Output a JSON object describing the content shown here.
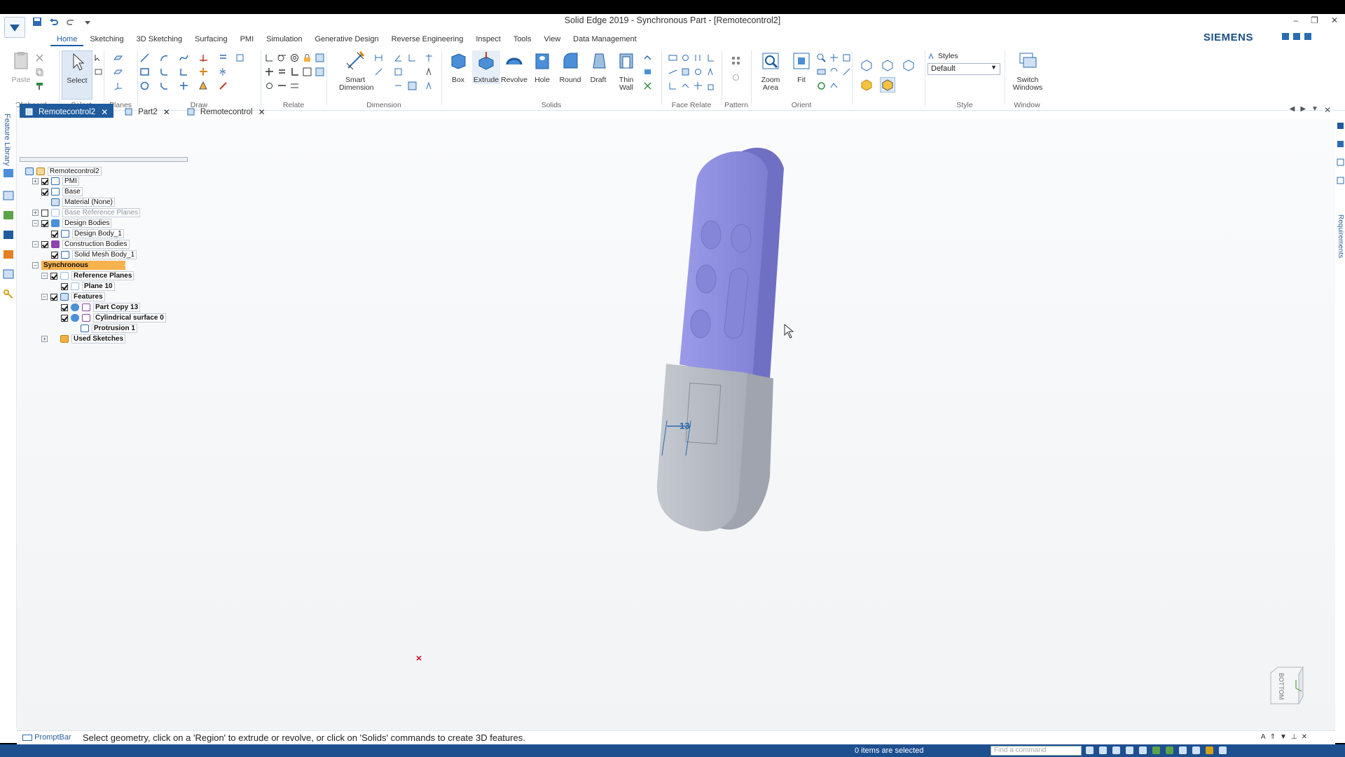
{
  "window": {
    "title": "Solid Edge 2019 - Synchronous Part - [Remotecontrol2]",
    "controls": [
      "–",
      "❐",
      "✕"
    ]
  },
  "brand": "SIEMENS",
  "ribbon_tabs": [
    "Home",
    "Sketching",
    "3D Sketching",
    "Surfacing",
    "PMI",
    "Simulation",
    "Generative Design",
    "Reverse Engineering",
    "Inspect",
    "Tools",
    "View",
    "Data Management"
  ],
  "ribbon": {
    "clipboard": {
      "paste": "Paste",
      "group": "Clipboard"
    },
    "select": {
      "select": "Select",
      "group": "Select"
    },
    "planes": {
      "group": "Planes"
    },
    "draw": {
      "group": "Draw"
    },
    "relate": {
      "group": "Relate"
    },
    "dimension": {
      "smart_dimension": "Smart Dimension",
      "group": "Dimension"
    },
    "solids": {
      "box": "Box",
      "extrude": "Extrude",
      "revolve": "Revolve",
      "hole": "Hole",
      "round": "Round",
      "draft": "Draft",
      "thin_wall": "Thin Wall",
      "group": "Solids"
    },
    "face_relate": {
      "group": "Face Relate"
    },
    "pattern": {
      "group": "Pattern"
    },
    "orient": {
      "zoom_area": "Zoom Area",
      "fit": "Fit",
      "group": "Orient"
    },
    "style": {
      "styles_label": "Styles",
      "style_value": "Default",
      "group": "Style"
    },
    "window": {
      "switch_windows": "Switch Windows",
      "group": "Window"
    }
  },
  "doc_tabs": [
    {
      "label": "Remotecontrol2",
      "active": true
    },
    {
      "label": "Part2",
      "active": false
    },
    {
      "label": "Remotecontrol",
      "active": false
    }
  ],
  "left_rail": {
    "label": "Feature Library"
  },
  "right_rail": {
    "label": "Requirements"
  },
  "tree": {
    "root": "Remotecontrol2",
    "pmi": "PMI",
    "base": "Base",
    "material": "Material (None)",
    "base_ref_planes": "Base Reference Planes",
    "design_bodies": "Design Bodies",
    "design_body_1": "Design Body_1",
    "construction_bodies": "Construction Bodies",
    "solid_mesh_body_1": "Solid Mesh Body_1",
    "synchronous": "Synchronous",
    "reference_planes": "Reference Planes",
    "plane_10": "Plane 10",
    "features": "Features",
    "part_copy_13": "Part Copy 13",
    "cyl_surface_0": "Cylindrical surface 0",
    "protrusion_1": "Protrusion 1",
    "used_sketches": "Used Sketches"
  },
  "model": {
    "dimension_value": "13",
    "top_color": "#8f8fe0",
    "bottom_color": "#b8bcc4"
  },
  "view_cube": {
    "label": "BOTTOM"
  },
  "prompt": {
    "label": "PromptBar",
    "text": "Select geometry, click on a 'Region' to extrude or revolve, or click on 'Solids' commands to create 3D features."
  },
  "status": {
    "selection": "0 items are selected",
    "find_placeholder": "Find a command"
  }
}
